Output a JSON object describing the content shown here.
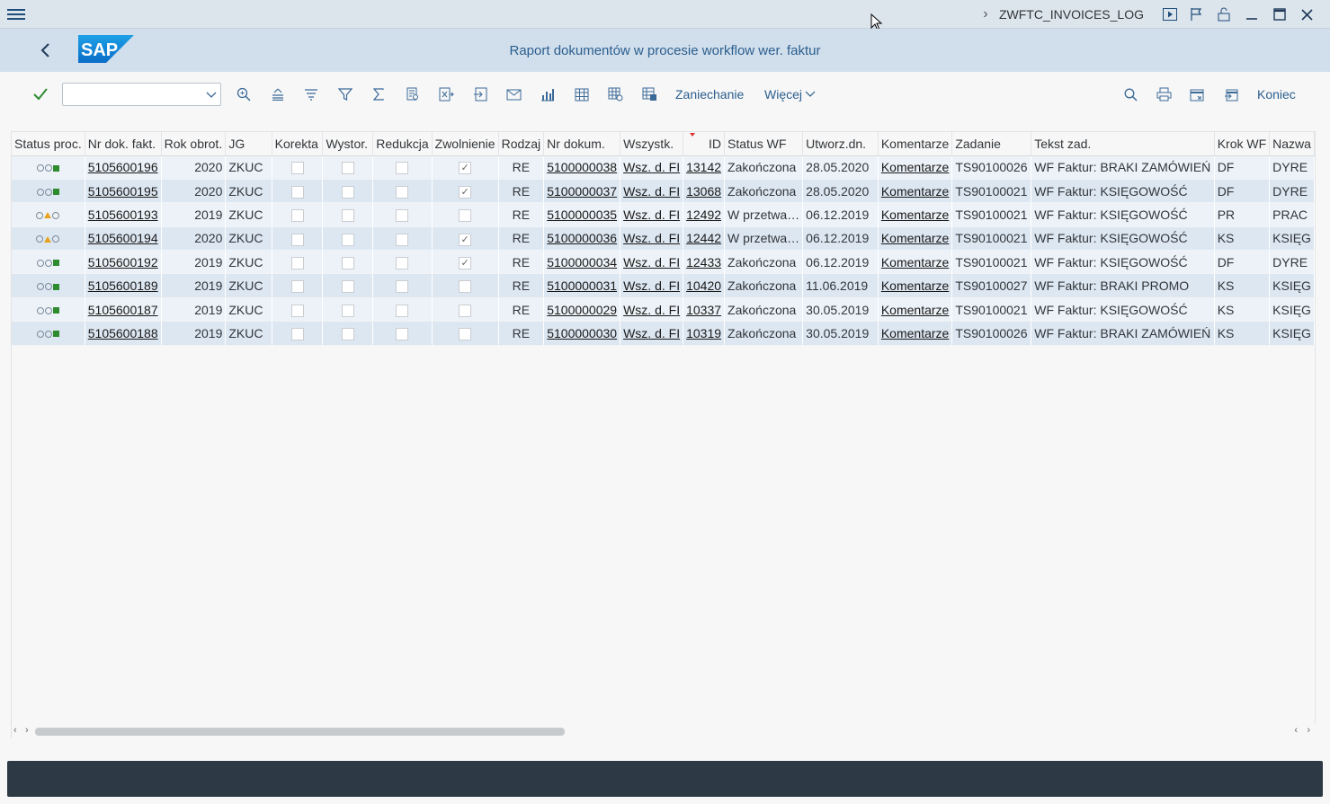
{
  "titlebar": {
    "transaction": "ZWFTC_INVOICES_LOG",
    "icons": [
      "menu-icon",
      "chevron-right-icon",
      "play-icon",
      "flag-icon",
      "unlock-icon",
      "minimize-icon",
      "maximize-icon",
      "close-icon"
    ]
  },
  "header": {
    "logo_text": "SAP",
    "title": "Raport dokumentów w procesie workflow wer. faktur"
  },
  "toolbar": {
    "command_value": "",
    "zaniechanie": "Zaniechanie",
    "wiecej": "Więcej",
    "koniec": "Koniec"
  },
  "table": {
    "columns": [
      "Status proc.",
      "Nr dok. fakt.",
      "Rok obrot.",
      "JG",
      "Korekta",
      "Wystor.",
      "Redukcja",
      "Zwolnienie",
      "Rodzaj",
      "Nr dokum.",
      "Wszystk.",
      "ID",
      "Status WF",
      "Utworz.dn.",
      "Komentarze",
      "Zadanie",
      "Tekst zad.",
      "Krok WF",
      "Nazwa"
    ],
    "rows": [
      {
        "status": "green",
        "nr_dok": "5105600196",
        "rok": "2020",
        "jg": "ZKUC",
        "zwolnienie": true,
        "rodzaj": "RE",
        "nr_dokum": "5100000038",
        "wszystk": "Wsz. d. FI",
        "id": "13142",
        "status_wf": "Zakończona",
        "utworz": "28.05.2020",
        "komentarze": "Komentarze",
        "zadanie": "TS90100026",
        "tekst": "WF Faktur: BRAKI ZAMÓWIEŃ",
        "krok": "DF",
        "nazwa": "DYRE"
      },
      {
        "status": "green",
        "nr_dok": "5105600195",
        "rok": "2020",
        "jg": "ZKUC",
        "zwolnienie": true,
        "rodzaj": "RE",
        "nr_dokum": "5100000037",
        "wszystk": "Wsz. d. FI",
        "id": "13068",
        "status_wf": "Zakończona",
        "utworz": "28.05.2020",
        "komentarze": "Komentarze",
        "zadanie": "TS90100021",
        "tekst": "WF Faktur: KSIĘGOWOŚĆ",
        "krok": "DF",
        "nazwa": "DYRE"
      },
      {
        "status": "yellow",
        "nr_dok": "5105600193",
        "rok": "2019",
        "jg": "ZKUC",
        "zwolnienie": false,
        "rodzaj": "RE",
        "nr_dokum": "5100000035",
        "wszystk": "Wsz. d. FI",
        "id": "12492",
        "status_wf": "W przetwa…",
        "utworz": "06.12.2019",
        "komentarze": "Komentarze",
        "zadanie": "TS90100021",
        "tekst": "WF Faktur: KSIĘGOWOŚĆ",
        "krok": "PR",
        "nazwa": "PRAC"
      },
      {
        "status": "yellow",
        "nr_dok": "5105600194",
        "rok": "2020",
        "jg": "ZKUC",
        "zwolnienie": true,
        "rodzaj": "RE",
        "nr_dokum": "5100000036",
        "wszystk": "Wsz. d. FI",
        "id": "12442",
        "status_wf": "W przetwa…",
        "utworz": "06.12.2019",
        "komentarze": "Komentarze",
        "zadanie": "TS90100021",
        "tekst": "WF Faktur: KSIĘGOWOŚĆ",
        "krok": "KS",
        "nazwa": "KSIĘG"
      },
      {
        "status": "green",
        "nr_dok": "5105600192",
        "rok": "2019",
        "jg": "ZKUC",
        "zwolnienie": true,
        "rodzaj": "RE",
        "nr_dokum": "5100000034",
        "wszystk": "Wsz. d. FI",
        "id": "12433",
        "status_wf": "Zakończona",
        "utworz": "06.12.2019",
        "komentarze": "Komentarze",
        "zadanie": "TS90100021",
        "tekst": "WF Faktur: KSIĘGOWOŚĆ",
        "krok": "DF",
        "nazwa": "DYRE"
      },
      {
        "status": "green",
        "nr_dok": "5105600189",
        "rok": "2019",
        "jg": "ZKUC",
        "zwolnienie": false,
        "rodzaj": "RE",
        "nr_dokum": "5100000031",
        "wszystk": "Wsz. d. FI",
        "id": "10420",
        "status_wf": "Zakończona",
        "utworz": "11.06.2019",
        "komentarze": "Komentarze",
        "zadanie": "TS90100027",
        "tekst": "WF Faktur: BRAKI PROMO",
        "krok": "KS",
        "nazwa": "KSIĘG"
      },
      {
        "status": "green",
        "nr_dok": "5105600187",
        "rok": "2019",
        "jg": "ZKUC",
        "zwolnienie": false,
        "rodzaj": "RE",
        "nr_dokum": "5100000029",
        "wszystk": "Wsz. d. FI",
        "id": "10337",
        "status_wf": "Zakończona",
        "utworz": "30.05.2019",
        "komentarze": "Komentarze",
        "zadanie": "TS90100021",
        "tekst": "WF Faktur: KSIĘGOWOŚĆ",
        "krok": "KS",
        "nazwa": "KSIĘG"
      },
      {
        "status": "green",
        "nr_dok": "5105600188",
        "rok": "2019",
        "jg": "ZKUC",
        "zwolnienie": false,
        "rodzaj": "RE",
        "nr_dokum": "5100000030",
        "wszystk": "Wsz. d. FI",
        "id": "10319",
        "status_wf": "Zakończona",
        "utworz": "30.05.2019",
        "komentarze": "Komentarze",
        "zadanie": "TS90100026",
        "tekst": "WF Faktur: BRAKI ZAMÓWIEŃ",
        "krok": "KS",
        "nazwa": "KSIĘG"
      }
    ]
  },
  "colors": {
    "header_bg": "#d1dfec",
    "accent": "#2b5e8e",
    "row_even": "#edf2f8",
    "row_odd": "#dde7f2",
    "footer": "#2d3a45",
    "status_green": "#2e8b2e",
    "status_yellow": "#e6a21f"
  }
}
